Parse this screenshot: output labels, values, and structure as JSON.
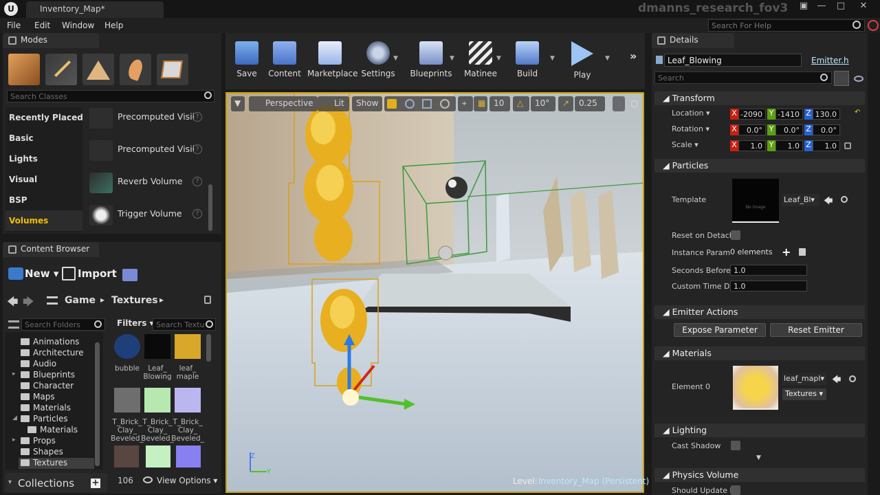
{
  "window": {
    "logo": "U",
    "tab_title": "Inventory_Map*",
    "project_name": "dmanns_research_fov3"
  },
  "menu": {
    "items": [
      "File",
      "Edit",
      "Window",
      "Help"
    ],
    "search_placeholder": "Search For Help"
  },
  "modes": {
    "tab_label": "Modes",
    "search_placeholder": "Search Classes",
    "categories": [
      "Recently Placed",
      "Basic",
      "Lights",
      "Visual",
      "BSP",
      "Volumes"
    ],
    "active_category": "Volumes",
    "items": [
      "Precomputed Visil",
      "Precomputed Visil",
      "Reverb Volume",
      "Trigger Volume"
    ]
  },
  "toolbar": {
    "buttons": [
      "Save",
      "Content",
      "Marketplace",
      "Settings",
      "Blueprints",
      "Matinee",
      "Build",
      "Play"
    ]
  },
  "viewport": {
    "perspective": "Perspective",
    "lit": "Lit",
    "show": "Show",
    "grid_snap": "10",
    "rot_snap": "10°",
    "scale_snap": "0.25",
    "level_label": "Level:",
    "level_name": "Inventory_Map (Persistent)",
    "axis_z": "Z",
    "axis_y": "Y"
  },
  "details": {
    "tab_label": "Details",
    "actor_name": "Leaf_Blowing",
    "actor_source": "Emitter.h",
    "search_placeholder": "Search",
    "transform": {
      "title": "Transform",
      "location_label": "Location",
      "rotation_label": "Rotation",
      "scale_label": "Scale",
      "axis_labels": [
        "X",
        "Y",
        "Z"
      ],
      "location": [
        "-2090",
        "-1410",
        "130.0"
      ],
      "rotation": [
        "0.0°",
        "0.0°",
        "0.0°"
      ],
      "scale": [
        "1.0",
        "1.0",
        "1.0"
      ]
    },
    "particles": {
      "title": "Particles",
      "template_label": "Template",
      "template_value": "Leaf_Bl",
      "thumb_text": "No Image",
      "reset_label": "Reset on Detach",
      "instance_label": "Instance Param",
      "instance_value": "0 elements",
      "seconds_label": "Seconds Before",
      "seconds_value": "1.0",
      "custom_label": "Custom Time D",
      "custom_value": "1.0"
    },
    "emitter_actions": {
      "title": "Emitter Actions",
      "expose": "Expose Parameter",
      "reset": "Reset Emitter"
    },
    "materials": {
      "title": "Materials",
      "element_label": "Element 0",
      "material_value": "leaf_mapl",
      "textures_value": "Textures"
    },
    "lighting": {
      "title": "Lighting",
      "cast_shadow": "Cast Shadow"
    },
    "physics": {
      "title": "Physics Volume",
      "should_update": "Should Update P"
    }
  },
  "content_browser": {
    "tab_label": "Content Browser",
    "new_label": "New",
    "import_label": "Import",
    "breadcrumb": [
      "Game",
      "Textures"
    ],
    "search_folders_placeholder": "Search Folders",
    "filters_label": "Filters",
    "search_textures_placeholder": "Search Textu",
    "folders": [
      {
        "name": "Animations",
        "indent": 0
      },
      {
        "name": "Architecture",
        "indent": 0
      },
      {
        "name": "Audio",
        "indent": 0
      },
      {
        "name": "Blueprints",
        "indent": 0
      },
      {
        "name": "Character",
        "indent": 0
      },
      {
        "name": "Maps",
        "indent": 0
      },
      {
        "name": "Materials",
        "indent": 0
      },
      {
        "name": "Particles",
        "indent": 0
      },
      {
        "name": "Materials",
        "indent": 1
      },
      {
        "name": "Props",
        "indent": 0
      },
      {
        "name": "Shapes",
        "indent": 0
      },
      {
        "name": "Textures",
        "indent": 0
      }
    ],
    "selected_folder": "Textures",
    "assets": [
      {
        "label": "bubble",
        "color": "#1f3f7a"
      },
      {
        "label": "Leaf_ Blowing",
        "color": "#0a0a0a"
      },
      {
        "label": "leaf_ maple",
        "color": "#d9a72a"
      },
      {
        "label": "T_Brick_ Clay_ Beveled_",
        "color": "#6e6e6e"
      },
      {
        "label": "T_Brick_ Clay_ Beveled_",
        "color": "#b7e8b0"
      },
      {
        "label": "T_Brick_ Clay_ Beveled_",
        "color": "#b9b6f0"
      }
    ],
    "item_count": "106",
    "view_options": "View Options",
    "collections": "Collections"
  }
}
